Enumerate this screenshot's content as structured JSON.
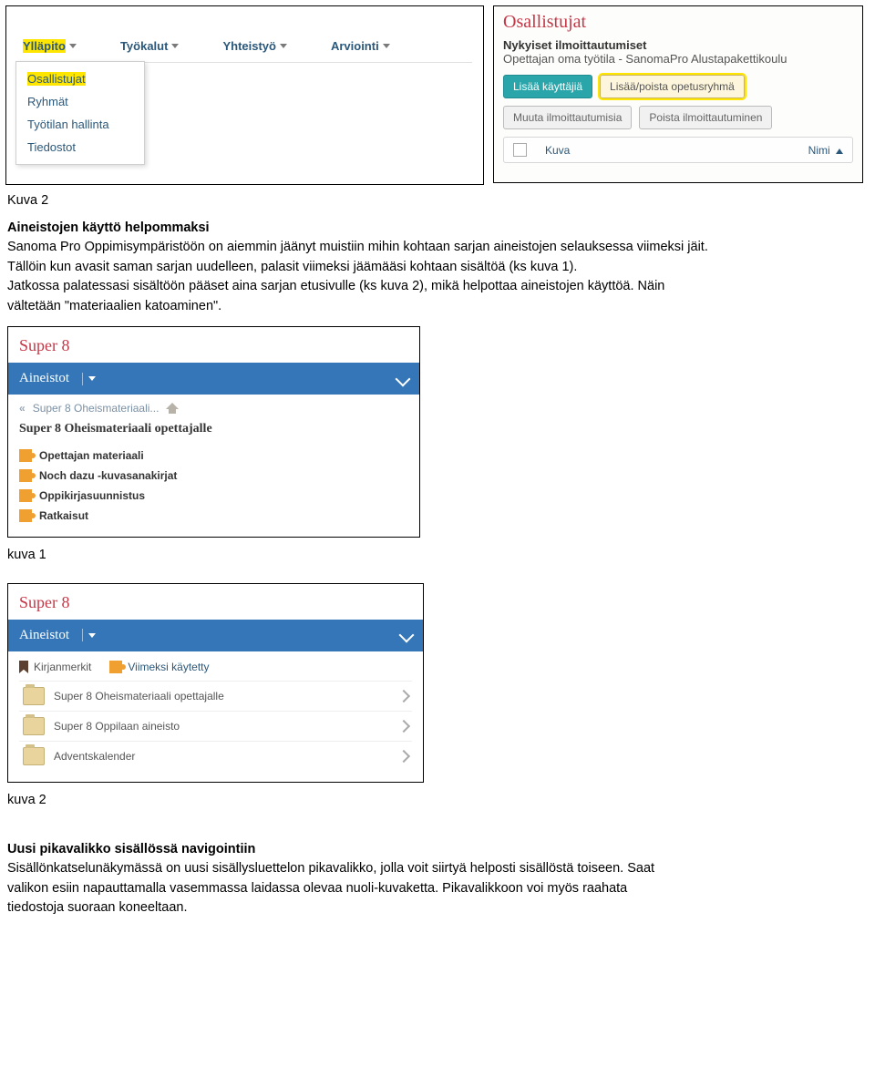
{
  "top_caption": "Kuva 2",
  "shot1": {
    "menu": [
      "Ylläpito",
      "Työkalut",
      "Yhteistyö",
      "Arviointi"
    ],
    "active_index": 0,
    "dropdown": [
      "Osallistujat",
      "Ryhmät",
      "Työtilan hallinta",
      "Tiedostot"
    ],
    "dropdown_highlight_index": 0
  },
  "shot2": {
    "title": "Osallistujat",
    "sub_bold": "Nykyiset ilmoittautumiset",
    "sub_text": "Opettajan oma työtila - SanomaPro Alustapakettikoulu",
    "btn_add_users": "Lisää käyttäjiä",
    "btn_add_remove_group": "Lisää/poista opetusryhmä",
    "btn_change": "Muuta ilmoittautumisia",
    "btn_remove": "Poista ilmoittautuminen",
    "col_kuva": "Kuva",
    "col_nimi": "Nimi"
  },
  "section1": {
    "heading": "Aineistojen käyttö helpommaksi",
    "p1": "Sanoma Pro Oppimisympäristöön on aiemmin jäänyt muistiin mihin kohtaan sarjan aineistojen selauksessa viimeksi jäit.",
    "p2": "Tällöin kun avasit saman sarjan uudelleen, palasit viimeksi jäämääsi kohtaan sisältöä (ks kuva 1).",
    "p3a": "Jatkossa palatessasi sisältöön pääset aina sarjan etusivulle (ks kuva 2), mikä helpottaa aineistojen käyttöä. Näin",
    "p3b": "vältetään \"materiaalien katoaminen\"."
  },
  "shot_aine1": {
    "super8": "Super 8",
    "header": "Aineistot",
    "breadcrumb_text": "Super 8 Oheismateriaali...",
    "subtitle": "Super 8 Oheismateriaali opettajalle",
    "items": [
      "Opettajan materiaali",
      "Noch dazu -kuvasanakirjat",
      "Oppikirjasuunnistus",
      "Ratkaisut"
    ]
  },
  "caption_kuva1": "kuva 1",
  "shot_aine2": {
    "super8": "Super 8",
    "header": "Aineistot",
    "bookmarks": "Kirjanmerkit",
    "recent": "Viimeksi käytetty",
    "folders": [
      "Super 8 Oheismateriaali opettajalle",
      "Super 8 Oppilaan aineisto",
      "Adventskalender"
    ]
  },
  "caption_kuva2": "kuva 2",
  "section2": {
    "heading": "Uusi pikavalikko sisällössä navigointiin",
    "p1a": "Sisällönkatselunäkymässä on uusi sisällysluettelon pikavalikko, jolla voit siirtyä helposti sisällöstä toiseen. Saat",
    "p1b": "valikon esiin napauttamalla vasemmassa laidassa olevaa nuoli-kuvaketta. Pikavalikkoon voi myös raahata",
    "p1c": "tiedostoja suoraan koneeltaan."
  }
}
